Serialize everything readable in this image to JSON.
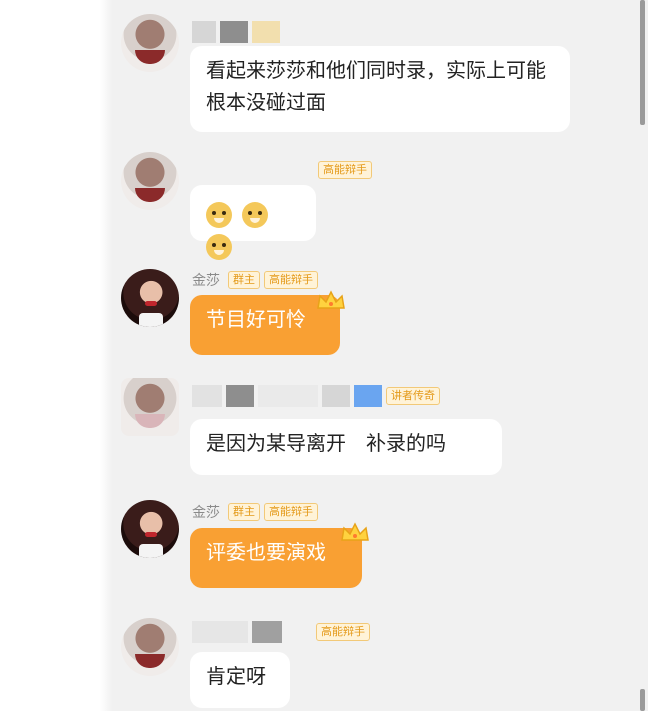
{
  "messages": [
    {
      "name": "",
      "badges": [],
      "text": "看起来莎莎和他们同时录，实际上可能根本没碰过面",
      "style": "white"
    },
    {
      "name": "",
      "badges": [
        "高能辩手"
      ],
      "text": "",
      "emoji": [
        "doge-emoji",
        "doge-emoji",
        "doge-emoji"
      ],
      "style": "white"
    },
    {
      "name": "金莎",
      "badges": [
        "群主",
        "高能辩手"
      ],
      "text": "节目好可怜",
      "style": "orange"
    },
    {
      "name": "",
      "badges": [
        "讲者传奇"
      ],
      "text": "是因为某导离开　补录的吗",
      "style": "white"
    },
    {
      "name": "金莎",
      "badges": [
        "群主",
        "高能辩手"
      ],
      "text": "评委也要演戏",
      "style": "orange"
    },
    {
      "name": "",
      "badges": [
        "高能辩手"
      ],
      "text": "肯定呀",
      "style": "white"
    }
  ],
  "colors": {
    "accent": "#f9a033",
    "badge_text": "#e49a1a",
    "background": "#f1f1f1"
  }
}
